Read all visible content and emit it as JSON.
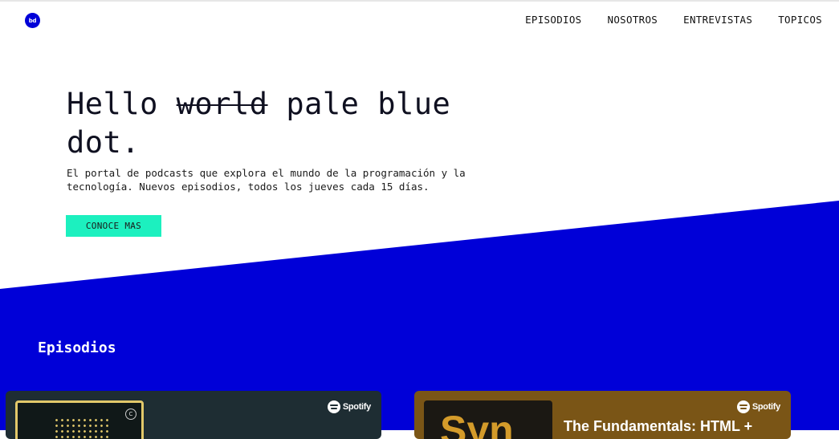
{
  "header": {
    "logo_text": "bd",
    "nav": [
      "EPISODIOS",
      "NOSOTROS",
      "ENTREVISTAS",
      "TOPICOS"
    ]
  },
  "hero": {
    "title_before": "Hello ",
    "title_struck": "world",
    "title_after": " pale blue dot.",
    "description": "El portal de podcasts que explora el mundo de la programación y la tecnología. Nuevos episodios, todos los jueves cada 15 días.",
    "cta_label": "CONOCE MAS"
  },
  "episodes": {
    "title": "Episodios",
    "cards": [
      {
        "provider": "Spotify",
        "cover_badge": "C",
        "title": ""
      },
      {
        "provider": "Spotify",
        "cover_word": "Syn",
        "title": "The Fundamentals: HTML +"
      }
    ]
  },
  "colors": {
    "brand_blue": "#0000d8",
    "accent_green": "#1cf0bf",
    "card_1_bg": "#1e2d33",
    "card_2_bg": "#7a5516"
  }
}
